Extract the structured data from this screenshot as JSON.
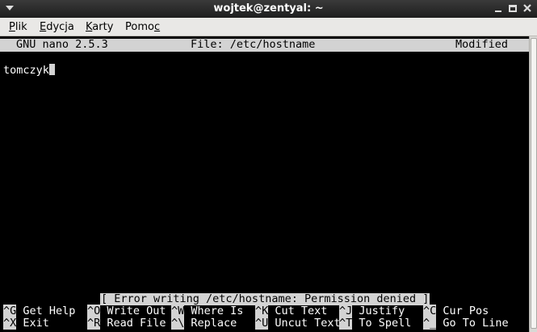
{
  "window": {
    "title": "wojtek@zentyal: ~"
  },
  "menubar": {
    "items": [
      {
        "mnemonic": "P",
        "rest": "lik"
      },
      {
        "mnemonic": "E",
        "rest": "dycja"
      },
      {
        "mnemonic": "K",
        "rest": "arty"
      },
      {
        "before": "Pomo",
        "mnemonic": "c"
      }
    ]
  },
  "nano": {
    "version": "GNU nano 2.5.3",
    "file": "File: /etc/hostname",
    "state": "Modified",
    "buffer": [
      "tomczyk"
    ],
    "status_message": "[ Error writing /etc/hostname: Permission denied ]",
    "shortcuts_row1": [
      {
        "key": "^G",
        "label": "Get Help"
      },
      {
        "key": "^O",
        "label": "Write Out"
      },
      {
        "key": "^W",
        "label": "Where Is"
      },
      {
        "key": "^K",
        "label": "Cut Text"
      },
      {
        "key": "^J",
        "label": "Justify"
      },
      {
        "key": "^C",
        "label": "Cur Pos"
      }
    ],
    "shortcuts_row2": [
      {
        "key": "^X",
        "label": "Exit"
      },
      {
        "key": "^R",
        "label": "Read File"
      },
      {
        "key": "^\\",
        "label": "Replace"
      },
      {
        "key": "^U",
        "label": "Uncut Text"
      },
      {
        "key": "^T",
        "label": "To Spell"
      },
      {
        "key": "^_",
        "label": "Go To Line"
      }
    ]
  }
}
